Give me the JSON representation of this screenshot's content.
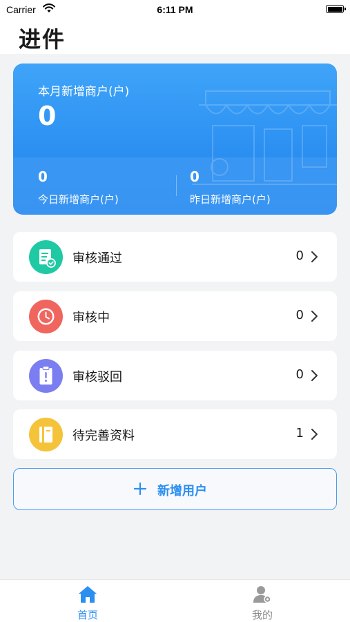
{
  "status_bar": {
    "carrier": "Carrier",
    "time": "6:11 PM"
  },
  "header": {
    "title": "进件"
  },
  "stats": {
    "month_label": "本月新增商户(户)",
    "month_value": "0",
    "today_value": "0",
    "today_label": "今日新增商户(户)",
    "yesterday_value": "0",
    "yesterday_label": "昨日新增商户(户)"
  },
  "review_list": [
    {
      "label": "审核通过",
      "count": "0",
      "icon": "document-check-icon",
      "color": "#1fc9a3"
    },
    {
      "label": "审核中",
      "count": "0",
      "icon": "clock-icon",
      "color": "#f0665e"
    },
    {
      "label": "审核驳回",
      "count": "0",
      "icon": "clipboard-alert-icon",
      "color": "#7b7ef0"
    },
    {
      "label": "待完善资料",
      "count": "1",
      "icon": "folder-icon",
      "color": "#f5c33a"
    }
  ],
  "add_button": {
    "label": "新增用户",
    "icon": "plus-icon"
  },
  "tab_bar": {
    "items": [
      {
        "label": "首页",
        "icon": "home-icon",
        "active": true
      },
      {
        "label": "我的",
        "icon": "user-gear-icon",
        "active": false
      }
    ]
  },
  "colors": {
    "accent": "#2b8ff2",
    "background": "#f2f3f5"
  }
}
